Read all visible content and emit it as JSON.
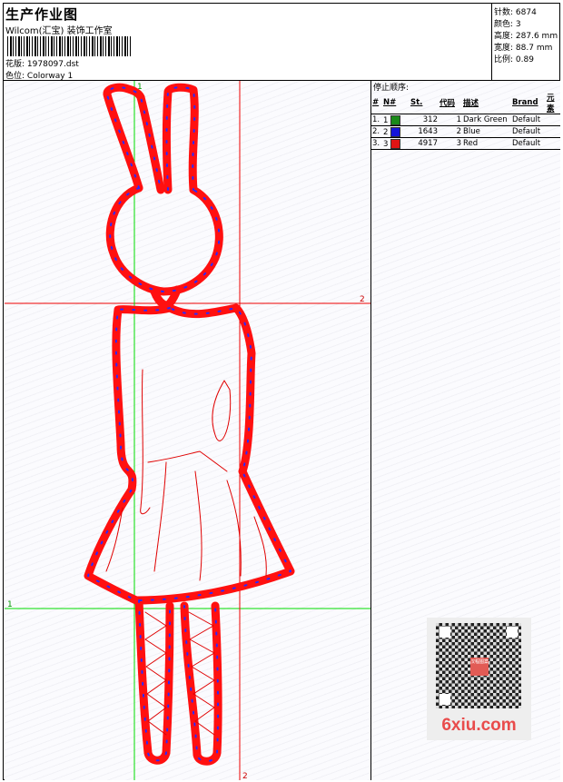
{
  "header": {
    "title": "生产作业图",
    "company": "Wilcom(汇宝) 装饰工作室",
    "design_label": "花版:",
    "design_value": "1978097.dst",
    "colorway_label": "色位:",
    "colorway_value": "Colorway 1"
  },
  "stats": [
    {
      "label": "针数:",
      "value": "6874"
    },
    {
      "label": "颜色:",
      "value": "3"
    },
    {
      "label": "高度:",
      "value": "287.6 mm"
    },
    {
      "label": "宽度:",
      "value": "88.7 mm"
    },
    {
      "label": "比例:",
      "value": "0.89"
    }
  ],
  "stop_sequence": {
    "title": "停止顺序:",
    "columns": [
      "#",
      "N#",
      "St.",
      "代码",
      "描述",
      "Brand",
      "元素"
    ],
    "rows": [
      {
        "idx": "1.",
        "n": "1",
        "color": "#1a8a1a",
        "st": "312",
        "code": "1",
        "desc": "Dark Green",
        "brand": "Default",
        "elem": ""
      },
      {
        "idx": "2.",
        "n": "2",
        "color": "#1414d8",
        "st": "1643",
        "code": "2",
        "desc": "Blue",
        "brand": "Default",
        "elem": ""
      },
      {
        "idx": "3.",
        "n": "3",
        "color": "#e01414",
        "st": "4917",
        "code": "3",
        "desc": "Red",
        "brand": "Default",
        "elem": ""
      }
    ]
  },
  "guides": {
    "h1": "2",
    "h2": "1",
    "v1": "1",
    "v2": "2"
  },
  "watermark": {
    "brand": "6xiu.com",
    "logo_text": "汉程图案"
  },
  "colors": {
    "stitch": "#ff0000",
    "guide_green": "#00dd00",
    "guide_red": "#ee0000"
  }
}
